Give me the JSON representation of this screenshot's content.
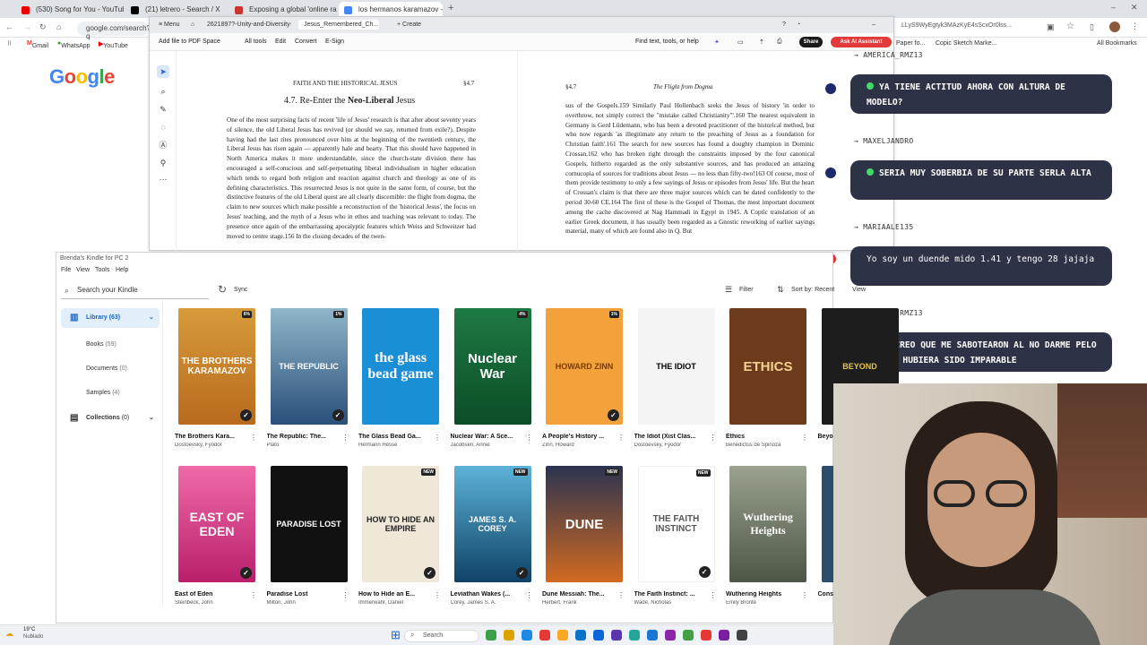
{
  "browser": {
    "tabs": [
      "(530) Song for You - YouTube",
      "(21) letrero - Search / X",
      "Exposing a global 'online rape",
      "los hermanos karamazov - Goo"
    ],
    "new_tab": "+",
    "url": "google.com/search?q",
    "url_right": "LLyS9WyEgtyk3MAzKyE4sScxOr0lss...",
    "bookmarks": [
      "Gmail",
      "WhatsApp",
      "YouTube",
      "Paper fo...",
      "Copic Sketch Marke...",
      "All Bookmarks"
    ],
    "google_logo": "Google"
  },
  "pdf": {
    "tabs": [
      "Menu",
      "2621897?-Unity-and-Diversity-i...",
      "Jesus_Remembered_Ch...",
      "Create"
    ],
    "toolbar": [
      "Add file to PDF Space",
      "All tools",
      "Edit",
      "Convert",
      "E-Sign"
    ],
    "find_text": "Find text, tools, or help",
    "share": "Share",
    "ai": "Ask AI Assistant",
    "page1": {
      "header": "FAITH AND THE HISTORICAL JESUS",
      "section": "§4.7",
      "heading_pre": "4.7. Re-Enter the",
      "heading_bold": "Neo-Liberal",
      "heading_post": "Jesus",
      "body": "One of the most surprising facts of recent 'life of Jesus' research is that after about seventy years of silence, the old Liberal Jesus has revived (or should we say, returned from exile?). Despite having had the last rites pronounced over him at the beginning of the twentieth century, the Liberal Jesus has risen again — apparently hale and hearty. That this should have happened in North America makes it more understandable, since the church-state division there has encouraged a self-conscious and self-perpetuating liberal individualism in higher education which tends to regard both religion and reaction against church and theology as one of its defining characteristics. This resurrected Jesus is not quite in the same form, of course, but the distinctive features of the old Liberal quest are all clearly discernible: the flight from dogma, the claim to new sources which make possible a reconstruction of the 'historical Jesus', the focus on Jesus' teaching, and the myth of a Jesus who in ethos and teaching was relevant to today. The presence once again of the embarrassing apocalyptic features which Weiss and Schweitzer had moved to centre stage.156 In the closing decades of the twen-"
    },
    "page2": {
      "section": "§4.7",
      "header": "The Flight from Dogma",
      "body": "sus of the Gospels.159 Similarly Paul Hollenbach seeks the Jesus of history 'in order to overthrow, not simply correct the \"mistake called Christianity\"'.160 The nearest equivalent in Germany is Gerd Lüdemann, who has been a devoted practitioner of the historical method, but who now regards 'as illegitimate any return to the preaching of Jesus as a foundation for Christian faith'.161 The search for new sources has found a doughty champion in Dominic Crossan,162 who has broken right through the constraints imposed by the four canonical Gospels, hitherto regarded as the only substantive sources, and has produced an amazing cornucopia of sources for traditions about Jesus — no less than fifty-two!163 Of course, most of them provide testimony to only a few sayings of Jesus or episodes from Jesus' life. But the heart of Crossan's claim is that there are three major sources which can be dated confidently to the period 30-60 CE.164 The first of these is the Gospel of Thomas, the most important document among the cache discovered at Nag Hammadi in Egypt in 1945. A Coptic translation of an earlier Greek document, it has usually been regarded as a Gnostic reworking of earlier sayings material, many of which are found also in Q. But"
    }
  },
  "chat": [
    {
      "user": "AMERICA_RMZ13",
      "msg": "YA TIENE ACTITUD AHORA CON ALTURA DE MODELO?",
      "dot": true
    },
    {
      "user": "MAXELJANDRO",
      "msg": "SERIA MUY SOBERBIA DE SU PARTE SERLA ALTA",
      "dot": true
    },
    {
      "user": "MARIAALE135",
      "msg": "Yo soy un duende mido 1.41 y tengo 28 jajaja",
      "dot": false
    },
    {
      "user": "AMERICA_RMZ13",
      "msg": "YO CREO QUE ME SABOTEARON AL NO DARME PELO LACIO, HUBIERA SIDO IMPARABLE",
      "dot": true
    }
  ],
  "kindle": {
    "window_title": "Brenda's Kindle for PC 2",
    "menu": [
      "File",
      "View",
      "Tools",
      "Help"
    ],
    "search_placeholder": "Search your Kindle",
    "sync": "Sync",
    "filter": "Filter",
    "sort": "Sort by: Recent",
    "view": "View",
    "sidebar": [
      {
        "label": "Library",
        "count": "(63)"
      },
      {
        "label": "Books",
        "count": "(59)"
      },
      {
        "label": "Documents",
        "count": "(0)"
      },
      {
        "label": "Samples",
        "count": "(4)"
      },
      {
        "label": "Collections",
        "count": "(0)"
      }
    ],
    "books_row1": [
      {
        "title": "The Brothers Kara...",
        "author": "Dostoevsky, Fyodor",
        "cover": "THE BROTHERS KARAMAZOV",
        "badge": "6%",
        "check": true
      },
      {
        "title": "The Republic: The...",
        "author": "Plato",
        "cover": "THE REPUBLIC",
        "badge": "1%",
        "check": true
      },
      {
        "title": "The Glass Bead Ga...",
        "author": "Hermann Hesse",
        "cover": "the glass bead game",
        "badge": "",
        "check": false
      },
      {
        "title": "Nuclear War: A Sce...",
        "author": "Jacobsen, Annie",
        "cover": "Nuclear War",
        "badge": "4%",
        "check": false
      },
      {
        "title": "A People's History ...",
        "author": "Zinn, Howard",
        "cover": "HOWARD ZINN",
        "badge": "1%",
        "check": true
      },
      {
        "title": "The Idiot (Xist Clas...",
        "author": "Dostoevsky, Fyodor",
        "cover": "THE IDIOT",
        "badge": "",
        "check": false
      },
      {
        "title": "Ethics",
        "author": "Benedictus de Spinoza",
        "cover": "ETHICS",
        "badge": "",
        "check": false
      },
      {
        "title": "Beyo...",
        "author": "",
        "cover": "BEYOND",
        "badge": "",
        "check": false
      }
    ],
    "books_row2": [
      {
        "title": "East of Eden",
        "author": "Steinbeck, John",
        "cover": "EAST OF EDEN",
        "badge": "",
        "check": true
      },
      {
        "title": "Paradise Lost",
        "author": "Milton, John",
        "cover": "PARADISE LOST",
        "badge": "",
        "check": false
      },
      {
        "title": "How to Hide an E...",
        "author": "Immerwahr, Daniel",
        "cover": "HOW TO HIDE AN EMPIRE",
        "badge": "NEW",
        "check": true
      },
      {
        "title": "Leviathan Wakes (...",
        "author": "Corey, James S. A.",
        "cover": "JAMES S. A. COREY",
        "badge": "NEW",
        "check": true
      },
      {
        "title": "Dune Messiah: The...",
        "author": "Herbert, Frank",
        "cover": "DUNE",
        "badge": "NEW",
        "check": false
      },
      {
        "title": "The Faith Instinct: ...",
        "author": "Wade, Nicholas",
        "cover": "THE FAITH INSTINCT",
        "badge": "NEW",
        "check": true
      },
      {
        "title": "Wuthering Heights",
        "author": "Emily Brontë",
        "cover": "Wuthering Heights",
        "badge": "",
        "check": false
      },
      {
        "title": "Cons...",
        "author": "",
        "cover": "",
        "badge": "",
        "check": false
      }
    ]
  },
  "taskbar": {
    "weather": "19°C",
    "weather_sub": "Nublado",
    "search": "Search"
  },
  "colors": {
    "chat_bubble": "#2e3247",
    "chat_dot": "#3ddc64",
    "ai_button": "#e23a3a",
    "kindle_selected": "#e3eefb"
  }
}
